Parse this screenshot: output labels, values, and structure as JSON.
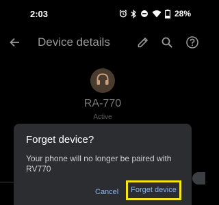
{
  "status_bar": {
    "time": "2:03",
    "battery_percent": "28%",
    "icons": [
      "alarm-icon",
      "bluetooth-icon",
      "do-not-disturb-icon",
      "wifi-icon",
      "battery-icon"
    ]
  },
  "app_bar": {
    "title": "Device details",
    "icons": [
      "back-arrow-icon",
      "edit-pencil-icon",
      "search-icon",
      "help-icon"
    ]
  },
  "device": {
    "name": "RA-770",
    "status": "Active",
    "icon": "headphones-icon",
    "avatar_color": "#4a3b2f"
  },
  "dialog": {
    "title": "Forget device?",
    "message": "Your phone will no longer be paired with RV770",
    "cancel_label": "Cancel",
    "confirm_label": "Forget device",
    "highlight_color": "#f7e41b",
    "button_text_color": "#8ab4f8"
  }
}
